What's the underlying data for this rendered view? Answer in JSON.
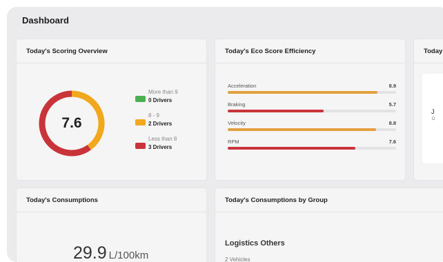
{
  "page": {
    "title": "Dashboard"
  },
  "scoring": {
    "title": "Today's Scoring Overview",
    "score": "7.6",
    "segments": [
      {
        "range": "More than 9",
        "count": "0 Drivers",
        "value": 0,
        "color": "#4caf50"
      },
      {
        "range": "8 - 9",
        "count": "2 Drivers",
        "value": 2,
        "color": "#f2a81d"
      },
      {
        "range": "Less than 8",
        "count": "3 Drivers",
        "value": 3,
        "color": "#c9343a"
      }
    ]
  },
  "eco": {
    "title": "Today's Eco Score Efficiency",
    "max": 10,
    "rows": [
      {
        "label": "Acceleration",
        "value": "8.9",
        "score": 8.9,
        "color": "#e3a03e"
      },
      {
        "label": "Braking",
        "value": "5.7",
        "score": 5.7,
        "color": "#c9343a"
      },
      {
        "label": "Velocity",
        "value": "8.8",
        "score": 8.8,
        "color": "#e3a03e"
      },
      {
        "label": "RPM",
        "value": "7.6",
        "score": 7.6,
        "color": "#c9343a"
      }
    ]
  },
  "partial": {
    "title": "Today",
    "letter": "J",
    "sub": "D"
  },
  "consumptions": {
    "title": "Today's Consumptions",
    "value": "29.9",
    "unit": "L/100km"
  },
  "group": {
    "title": "Today's Consumptions by Group",
    "name": "Logistics Others",
    "vehicles": "2 Vehicles"
  }
}
